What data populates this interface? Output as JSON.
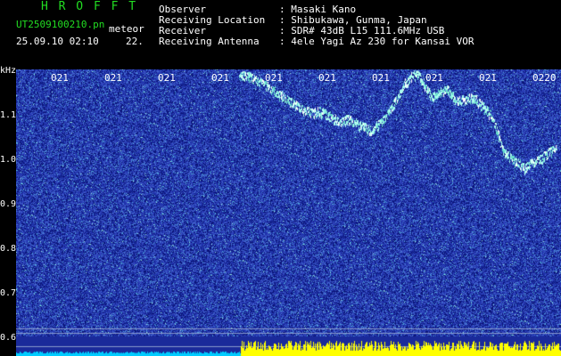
{
  "header": {
    "title": "H R O F F T",
    "filename": "UT2509100210.pn",
    "tag": "meteor",
    "datetime": "25.09.10 02:10",
    "extra": "22.",
    "info_labels": [
      "Observer",
      "Receiving Location",
      "Receiver",
      "Receiving Antenna"
    ],
    "info_values": [
      ": Masaki Kano",
      ": Shibukawa, Gunma, Japan",
      ": SDR# 43dB L15 111.6MHz USB",
      ": 4ele Yagi Az 230 for Kansai VOR"
    ]
  },
  "axis": {
    "unit": "kHz",
    "y_labels": [
      "1.1",
      "1.0",
      "0.9",
      "0.8",
      "0.7",
      "0.6"
    ],
    "x_labels": [
      "021",
      "021",
      "021",
      "021",
      "021",
      "021",
      "021",
      "021",
      "021",
      "0220"
    ]
  },
  "colors": {
    "background": "#1a2a9a",
    "trace": "#aaffee",
    "footer_yellow": "#ffff00",
    "footer_cyan": "#00ccff"
  }
}
